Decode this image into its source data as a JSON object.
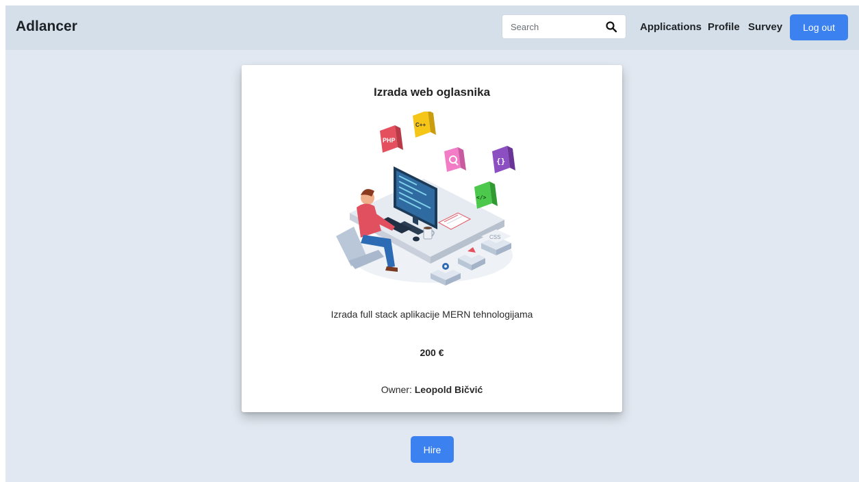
{
  "navbar": {
    "brand": "Adlancer",
    "search": {
      "placeholder": "Search",
      "value": ""
    },
    "links": [
      "Applications",
      "Profile",
      "Survey"
    ],
    "logout_label": "Log out"
  },
  "job": {
    "title": "Izrada web oglasnika",
    "description": "Izrada full stack aplikacije MERN tehnologijama",
    "price": "200 €",
    "owner_label": "Owner:",
    "owner_name": "Leopold Bičvić",
    "image_labels": [
      "PHP",
      "C++",
      "{}",
      "</>",
      "CSS"
    ]
  },
  "hire_label": "Hire",
  "colors": {
    "primary": "#3b82f0",
    "navbar_bg": "#d5dfea",
    "page_bg": "#e1e8f1"
  }
}
